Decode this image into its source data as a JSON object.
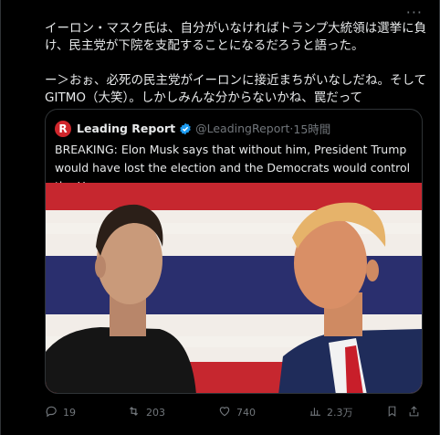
{
  "tweet": {
    "text_line1": "イーロン・マスク氏は、自分がいなければトランプ大統領は選挙に負け、民主党が下院を支配することになるだろうと語った。",
    "text_line2": "ー＞おぉ、必死の民主党がイーロンに接近まちがいなしだね。そしてGITMO（大笑）。しかしみんな分からないかね、罠だって",
    "more_label": "···"
  },
  "quote": {
    "logo_letter": "R",
    "name": "Leading Report",
    "handle": "@LeadingReport",
    "separator": " · ",
    "time": "15時間",
    "text": "BREAKING: Elon Musk says that without him, President Trump would have lost the election and the Democrats would control the House.",
    "brand_color": "#d0262c",
    "verified_color": "#1d9bf0"
  },
  "actions": {
    "replies": "19",
    "retweets": "203",
    "likes": "740",
    "views": "2.3万"
  },
  "icons": [
    "more-icon",
    "verified-icon",
    "reply-icon",
    "retweet-icon",
    "like-icon",
    "views-icon",
    "bookmark-icon",
    "share-icon"
  ]
}
